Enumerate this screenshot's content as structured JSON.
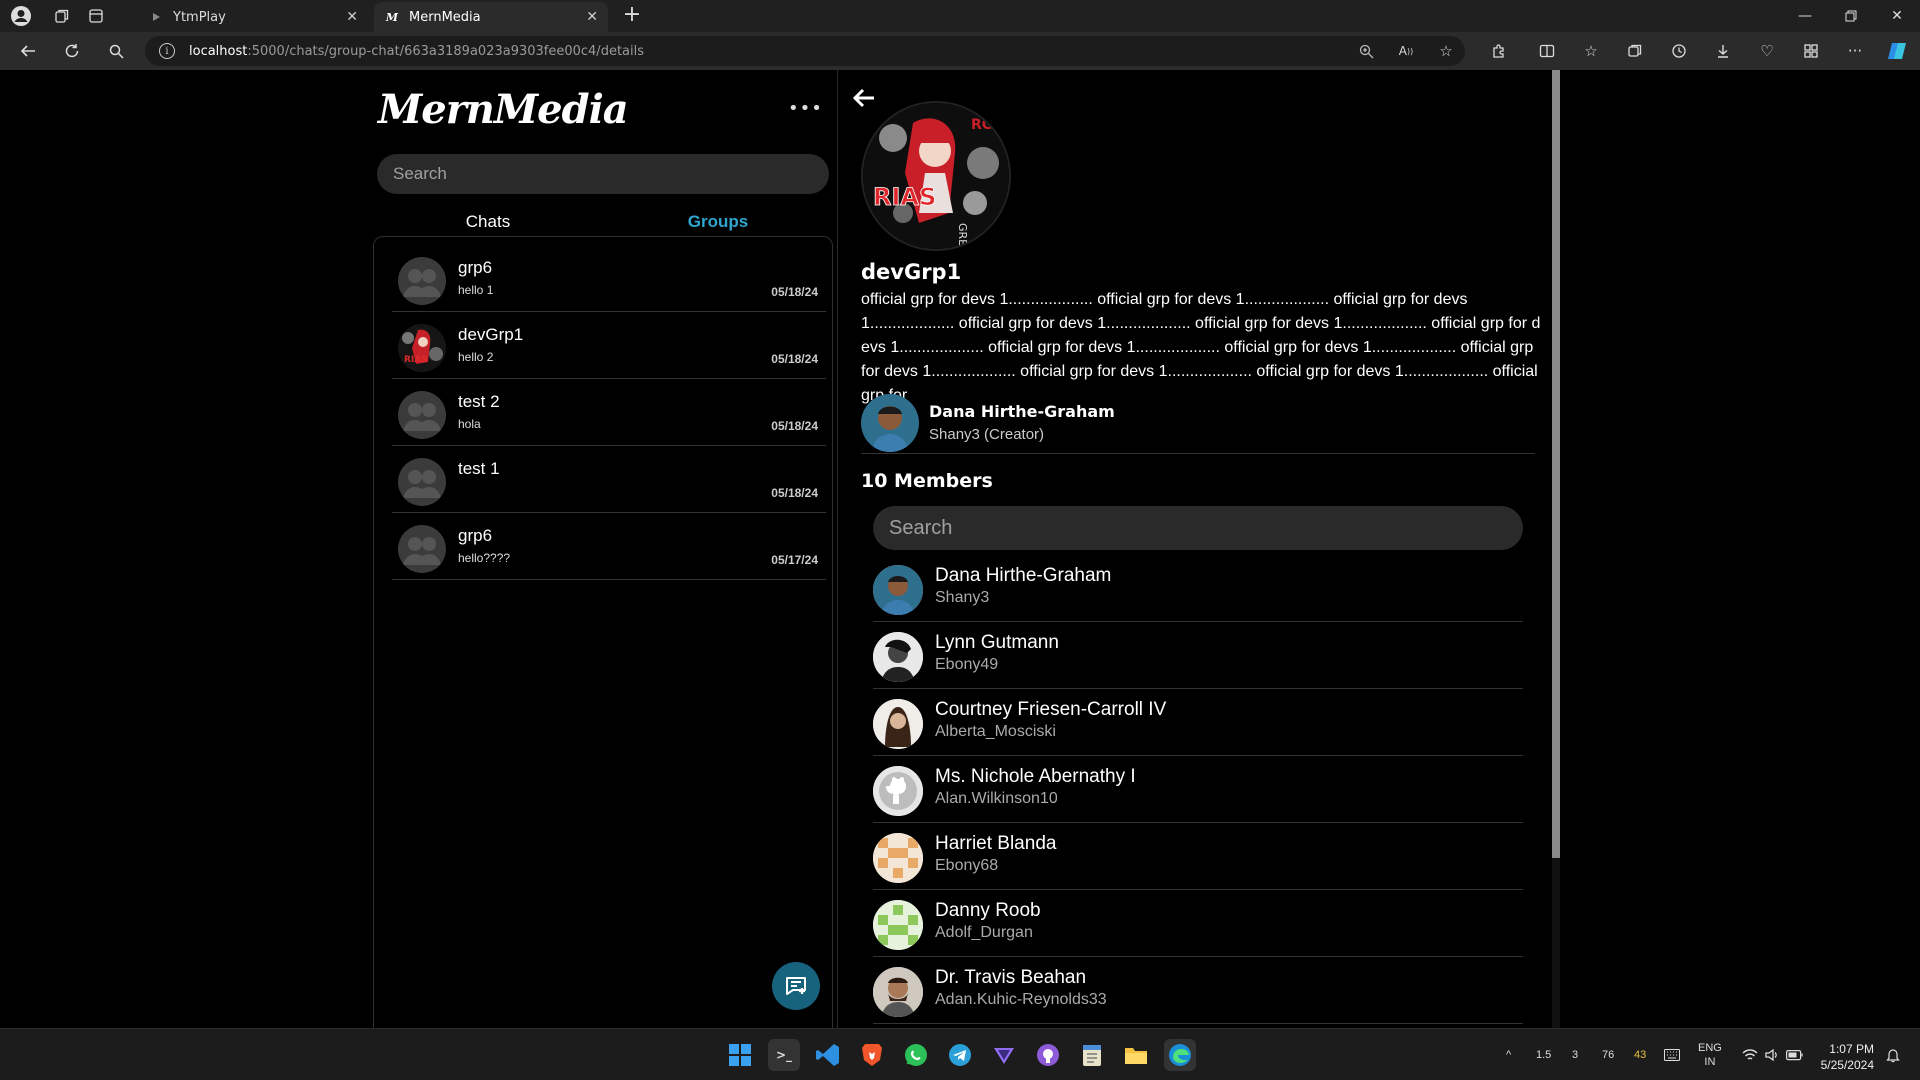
{
  "browser": {
    "tabs": [
      {
        "label": "YtmPlay",
        "favicon": "ytmplay-favicon"
      },
      {
        "label": "MernMedia",
        "favicon": "mernmedia-favicon"
      }
    ],
    "url_host": "localhost",
    "url_path": ":5000/chats/group-chat/663a3189a023a9303fee00c4/details"
  },
  "app": {
    "logo": "MernMedia",
    "more_label": "•••",
    "search_placeholder": "Search",
    "tabs": {
      "chats": "Chats",
      "groups": "Groups",
      "active": "groups"
    },
    "accent_color": "#2fa6ce",
    "chats": [
      {
        "name": "grp6",
        "message": "hello 1",
        "date": "05/18/24",
        "avatar": "group-placeholder"
      },
      {
        "name": "devGrp1",
        "message": "hello 2",
        "date": "05/18/24",
        "avatar": "rias-image"
      },
      {
        "name": "test 2",
        "message": "hola",
        "date": "05/18/24",
        "avatar": "group-placeholder"
      },
      {
        "name": "test 1",
        "message": "",
        "date": "05/18/24",
        "avatar": "group-placeholder"
      },
      {
        "name": "grp6",
        "message": "hello????",
        "date": "05/17/24",
        "avatar": "group-placeholder"
      }
    ]
  },
  "details": {
    "group_name": "devGrp1",
    "description": "official grp for devs 1................... official grp for devs 1................... official grp for devs 1................... official grp for devs 1................... official grp for devs 1................... official grp for devs 1................... official grp for devs 1................... official grp for devs 1................... official grp for devs 1................... official grp for devs 1................... official grp for devs 1................... official grp for",
    "creator": {
      "name": "Dana Hirthe-Graham",
      "role": "Shany3 (Creator)"
    },
    "members_title": "10 Members",
    "search_placeholder": "Search",
    "members": [
      {
        "name": "Dana Hirthe-Graham",
        "username": "Shany3",
        "avatar": "photo"
      },
      {
        "name": "Lynn Gutmann",
        "username": "Ebony49",
        "avatar": "photo"
      },
      {
        "name": "Courtney Friesen-Carroll IV",
        "username": "Alberta_Mosciski",
        "avatar": "photo"
      },
      {
        "name": "Ms. Nichole Abernathy I",
        "username": "Alan.Wilkinson10",
        "avatar": "github-icon"
      },
      {
        "name": "Harriet Blanda",
        "username": "Ebony68",
        "avatar": "identicon-orange"
      },
      {
        "name": "Danny Roob",
        "username": "Adolf_Durgan",
        "avatar": "identicon-green"
      },
      {
        "name": "Dr. Travis Beahan",
        "username": "Adan.Kuhic-Reynolds33",
        "avatar": "photo"
      }
    ]
  },
  "taskbar": {
    "tray_values": [
      "1.5",
      "3",
      "76",
      "43"
    ],
    "language": "ENG",
    "region": "IN",
    "time": "1:07 PM",
    "date": "5/25/2024"
  }
}
